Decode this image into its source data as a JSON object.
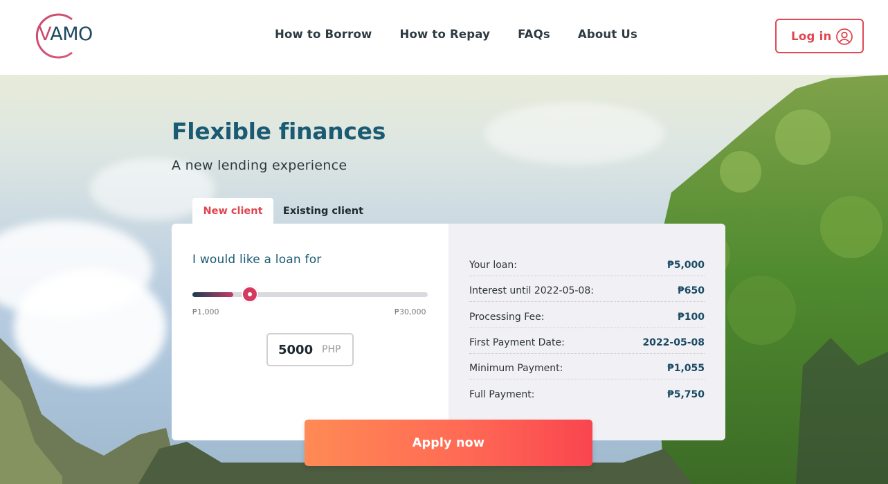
{
  "header": {
    "logo_text": "VAMO",
    "nav": [
      {
        "label": "How to Borrow"
      },
      {
        "label": "How to Repay"
      },
      {
        "label": "FAQs"
      },
      {
        "label": "About Us"
      }
    ],
    "login_label": "Log in"
  },
  "hero": {
    "title": "Flexible finances",
    "subtitle": "A new lending experience"
  },
  "tabs": [
    {
      "label": "New client",
      "active": true
    },
    {
      "label": "Existing client",
      "active": false
    }
  ],
  "loan_form": {
    "heading": "I would like a loan for",
    "slider": {
      "min_label": "₱1,000",
      "max_label": "₱30,000",
      "min": 1000,
      "max": 30000,
      "value": 5000
    },
    "amount_value": "5000",
    "amount_unit": "PHP"
  },
  "summary": [
    {
      "label": "Your loan:",
      "value": "₱5,000"
    },
    {
      "label": "Interest until 2022-05-08:",
      "value": "₱650"
    },
    {
      "label": "Processing Fee:",
      "value": "₱100"
    },
    {
      "label": "First Payment Date:",
      "value": "2022-05-08"
    },
    {
      "label": "Minimum Payment:",
      "value": "₱1,055"
    },
    {
      "label": "Full Payment:",
      "value": "₱5,750"
    }
  ],
  "apply_label": "Apply now",
  "colors": {
    "brand_teal": "#1a5a73",
    "accent_red": "#e0454f",
    "apply_gradient_start": "#ff8a55",
    "apply_gradient_end": "#f9454f"
  }
}
